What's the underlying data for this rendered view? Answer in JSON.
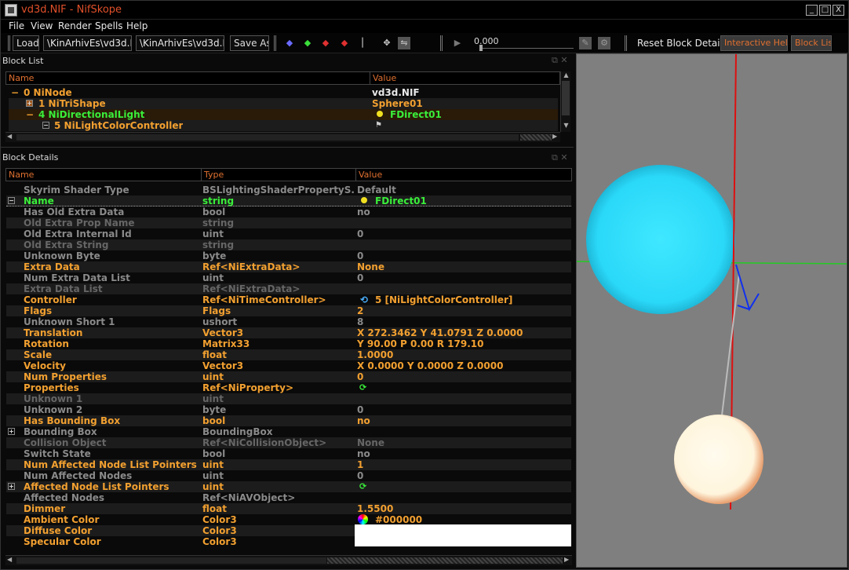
{
  "window": {
    "title": "vd3d.NIF - NifSkope",
    "min": "_",
    "max": "□",
    "close": "X"
  },
  "menu": [
    "File",
    "View",
    "Render",
    "Spells",
    "Help"
  ],
  "toolbar": {
    "load": "Load",
    "load_path": "\\KinArhivEs\\vd3d.NIF",
    "save_path": "\\KinArhivEs\\vd3d.NIF",
    "save_as": "Save As",
    "time_value": "0.000",
    "reset_block_details": "Reset Block Details",
    "interactive_help": "Interactive Help",
    "block_list": "Block List"
  },
  "block_list": {
    "title": "Block List",
    "col_name": "Name",
    "col_value": "Value",
    "rows": [
      {
        "expander": "−",
        "name": "0 NiNode",
        "value": "vd3d.NIF"
      },
      {
        "expander": "+",
        "name": "1 NiTriShape",
        "value": "Sphere01"
      },
      {
        "expander": "−",
        "name": "4 NiDirectionalLight",
        "value": "FDirect01"
      },
      {
        "expander": "−",
        "name": "5 NiLightColorController",
        "value": ""
      }
    ]
  },
  "block_details": {
    "title": "Block Details",
    "col_name": "Name",
    "col_type": "Type",
    "col_value": "Value",
    "rows": [
      {
        "name": "Skyrim Shader Type",
        "type": "BSLightingShaderPropertyS...",
        "value": "Default",
        "style": "grey"
      },
      {
        "name": "Name",
        "type": "string",
        "value": "FDirect01",
        "style": "green"
      },
      {
        "name": "Has Old Extra Data",
        "type": "bool",
        "value": "no",
        "style": "grey"
      },
      {
        "name": "Old Extra Prop Name",
        "type": "string",
        "value": "",
        "style": "dark"
      },
      {
        "name": "Old Extra Internal Id",
        "type": "uint",
        "value": "0",
        "style": "grey"
      },
      {
        "name": "Old Extra String",
        "type": "string",
        "value": "",
        "style": "dark"
      },
      {
        "name": "Unknown Byte",
        "type": "byte",
        "value": "0",
        "style": "grey"
      },
      {
        "name": "Extra Data",
        "type": "Ref<NiExtraData>",
        "value": "None",
        "style": "orange"
      },
      {
        "name": "Num Extra Data List",
        "type": "uint",
        "value": "0",
        "style": "grey"
      },
      {
        "name": "Extra Data List",
        "type": "Ref<NiExtraData>",
        "value": "",
        "style": "dark"
      },
      {
        "name": "Controller",
        "type": "Ref<NiTimeController>",
        "value": "5 [NiLightColorController]",
        "style": "orange"
      },
      {
        "name": "Flags",
        "type": "Flags",
        "value": "2",
        "style": "orange"
      },
      {
        "name": "Unknown Short 1",
        "type": "ushort",
        "value": "8",
        "style": "grey"
      },
      {
        "name": "Translation",
        "type": "Vector3",
        "value": "X 272.3462 Y 41.0791 Z 0.0000",
        "style": "orange"
      },
      {
        "name": "Rotation",
        "type": "Matrix33",
        "value": "Y 90.00 P 0.00 R 179.10",
        "style": "orange"
      },
      {
        "name": "Scale",
        "type": "float",
        "value": "1.0000",
        "style": "orange"
      },
      {
        "name": "Velocity",
        "type": "Vector3",
        "value": "X 0.0000 Y 0.0000 Z 0.0000",
        "style": "orange"
      },
      {
        "name": "Num Properties",
        "type": "uint",
        "value": "0",
        "style": "orange"
      },
      {
        "name": "Properties",
        "type": "Ref<NiProperty>",
        "value": "",
        "style": "orange"
      },
      {
        "name": "Unknown 1",
        "type": "uint",
        "value": "",
        "style": "dark"
      },
      {
        "name": "Unknown 2",
        "type": "byte",
        "value": "0",
        "style": "grey"
      },
      {
        "name": "Has Bounding Box",
        "type": "bool",
        "value": "no",
        "style": "orange"
      },
      {
        "name": "Bounding Box",
        "type": "BoundingBox",
        "value": "",
        "style": "grey"
      },
      {
        "name": "Collision Object",
        "type": "Ref<NiCollisionObject>",
        "value": "None",
        "style": "dark"
      },
      {
        "name": "Switch State",
        "type": "bool",
        "value": "no",
        "style": "grey"
      },
      {
        "name": "Num Affected Node List Pointers",
        "type": "uint",
        "value": "1",
        "style": "orange"
      },
      {
        "name": "Num Affected Nodes",
        "type": "uint",
        "value": "0",
        "style": "grey"
      },
      {
        "name": "Affected Node List Pointers",
        "type": "uint",
        "value": "",
        "style": "orange"
      },
      {
        "name": "Affected Nodes",
        "type": "Ref<NiAVObject>",
        "value": "",
        "style": "grey"
      },
      {
        "name": "Dimmer",
        "type": "float",
        "value": "1.5500",
        "style": "orange"
      },
      {
        "name": "Ambient Color",
        "type": "Color3",
        "value": "#000000",
        "style": "orange"
      },
      {
        "name": "Diffuse Color",
        "type": "Color3",
        "value": "#ffffff",
        "style": "orange"
      },
      {
        "name": "Specular Color",
        "type": "Color3",
        "value": "#ffffff",
        "style": "orange"
      }
    ]
  },
  "colors": {
    "accent": "#f2a030",
    "selected": "#3aee3a",
    "title": "#e0502a"
  }
}
